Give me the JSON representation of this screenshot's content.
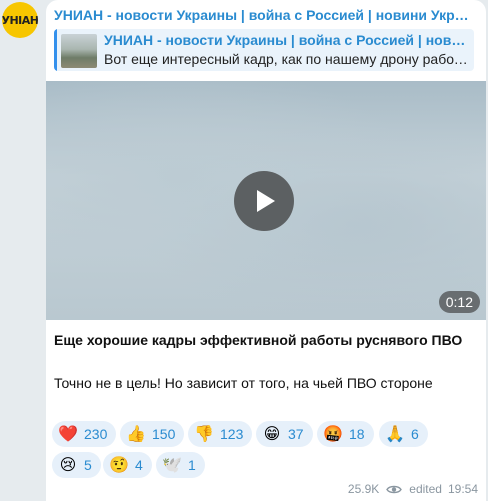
{
  "channel": {
    "name": "УНИАН - новости Украины | война с Россией | новини України...",
    "avatar_text": "УНIАН"
  },
  "reply": {
    "title": "УНИАН - новости Украины | война с Россией | новини України...",
    "text": "Вот еще интересный кадр, как по нашему дрону работ..."
  },
  "video": {
    "duration": "0:12"
  },
  "message": {
    "title": "Еще хорошие кадры эффективной работы руснявого ПВО",
    "body": "Точно не в цель! Но зависит от того, на чьей ПВО стороне"
  },
  "reactions": [
    {
      "emoji": "❤️",
      "icon": "heart-icon",
      "count": "230"
    },
    {
      "emoji": "👍",
      "icon": "thumbs-up-icon",
      "count": "150"
    },
    {
      "emoji": "👎",
      "icon": "thumbs-down-icon",
      "count": "123"
    },
    {
      "emoji": "😁",
      "icon": "grin-icon",
      "count": "37"
    },
    {
      "emoji": "🤬",
      "icon": "cursing-face-icon",
      "count": "18"
    },
    {
      "emoji": "🙏",
      "icon": "pray-icon",
      "count": "6"
    },
    {
      "emoji": "😢",
      "icon": "crying-face-icon",
      "count": "5"
    },
    {
      "emoji": "🤨",
      "icon": "raised-eyebrow-icon",
      "count": "4"
    },
    {
      "emoji": "🕊️",
      "icon": "dove-icon",
      "count": "1"
    }
  ],
  "meta": {
    "views": "25.9K",
    "edited_label": "edited",
    "time": "19:54"
  },
  "colors": {
    "accent": "#2a8bd0",
    "reaction_bg": "#e6f0fa",
    "background": "#e6ebee"
  }
}
